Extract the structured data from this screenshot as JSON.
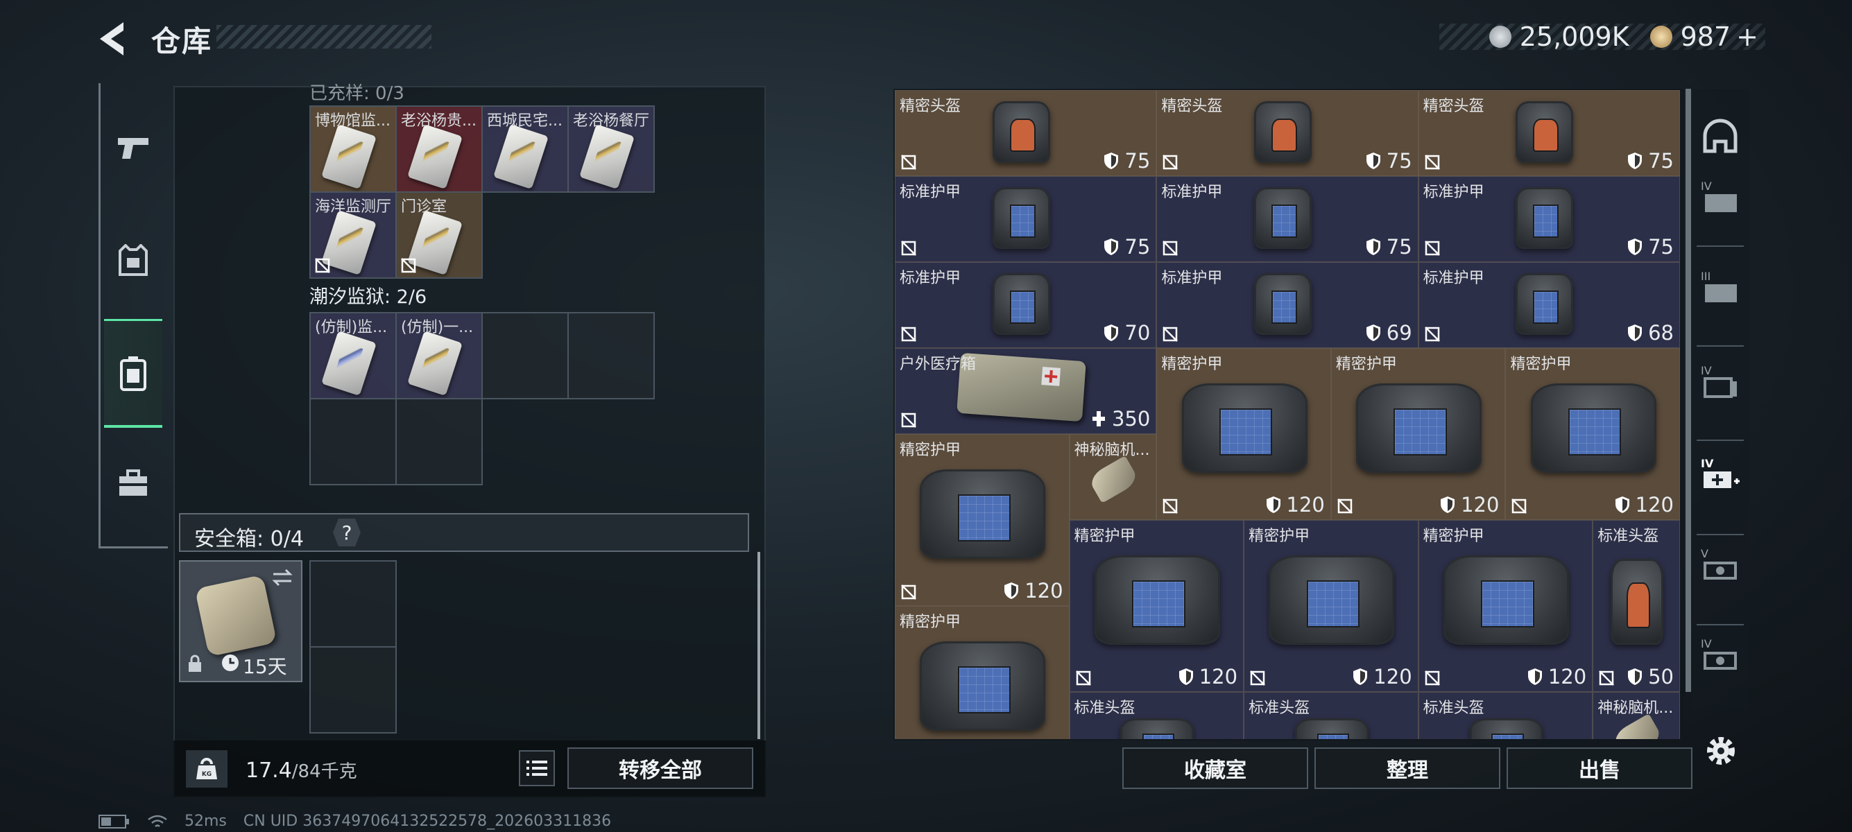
{
  "header": {
    "title": "仓库",
    "currency_silver": "25,009K",
    "currency_gold": "987",
    "plus": "+"
  },
  "left_sidebar": {
    "tabs": [
      "weapon-tab",
      "equipment-tab",
      "backpack-tab",
      "tools-tab"
    ],
    "active": 2
  },
  "keycards": {
    "partial_header": "已充样: 0/3",
    "row1": [
      "博物馆监...",
      "老浴杨贵...",
      "西城民宅...",
      "老浴杨餐厅"
    ],
    "row2": [
      "海洋监测厅",
      "门诊室"
    ],
    "section_label": "潮汐监狱: 2/6",
    "row3": [
      "(仿制)监...",
      "(仿制)一..."
    ]
  },
  "safebox": {
    "label": "安全箱: 0/4",
    "help": "?",
    "days": "15天"
  },
  "footer_left": {
    "weight": "17.4",
    "weight_max": "/84千克",
    "transfer_all": "转移全部"
  },
  "stash_items": [
    {
      "name": "精密头盔",
      "value": "75"
    },
    {
      "name": "精密头盔",
      "value": "75"
    },
    {
      "name": "精密头盔",
      "value": "75"
    },
    {
      "name": "标准护甲",
      "value": "75"
    },
    {
      "name": "标准护甲",
      "value": "75"
    },
    {
      "name": "标准护甲",
      "value": "75"
    },
    {
      "name": "标准护甲",
      "value": "70"
    },
    {
      "name": "标准护甲",
      "value": "69"
    },
    {
      "name": "标准护甲",
      "value": "68"
    },
    {
      "name": "户外医疗箱",
      "value": "350"
    },
    {
      "name": "精密护甲",
      "value": "120"
    },
    {
      "name": "精密护甲",
      "value": "120"
    },
    {
      "name": "精密护甲",
      "value": "120"
    },
    {
      "name": "精密护甲",
      "value": "120"
    },
    {
      "name": "神秘脑机..."
    },
    {
      "name": "精密护甲",
      "value": "120"
    },
    {
      "name": "精密护甲",
      "value": "120"
    },
    {
      "name": "精密护甲",
      "value": "120"
    },
    {
      "name": "标准头盔",
      "value": "50"
    },
    {
      "name": "精密护甲"
    },
    {
      "name": "标准头盔"
    },
    {
      "name": "标准头盔"
    },
    {
      "name": "标准头盔"
    },
    {
      "name": "神秘脑机..."
    }
  ],
  "footer_right": {
    "collection": "收藏室",
    "organize": "整理",
    "sell": "出售"
  },
  "status": {
    "ping": "52ms",
    "uid": "CN UID 3637497064132522578_202603311836"
  },
  "colors": {
    "accent_green": "#5de5a5",
    "tile_brown": "#5a4b3b",
    "tile_navy": "#2c2f48"
  }
}
